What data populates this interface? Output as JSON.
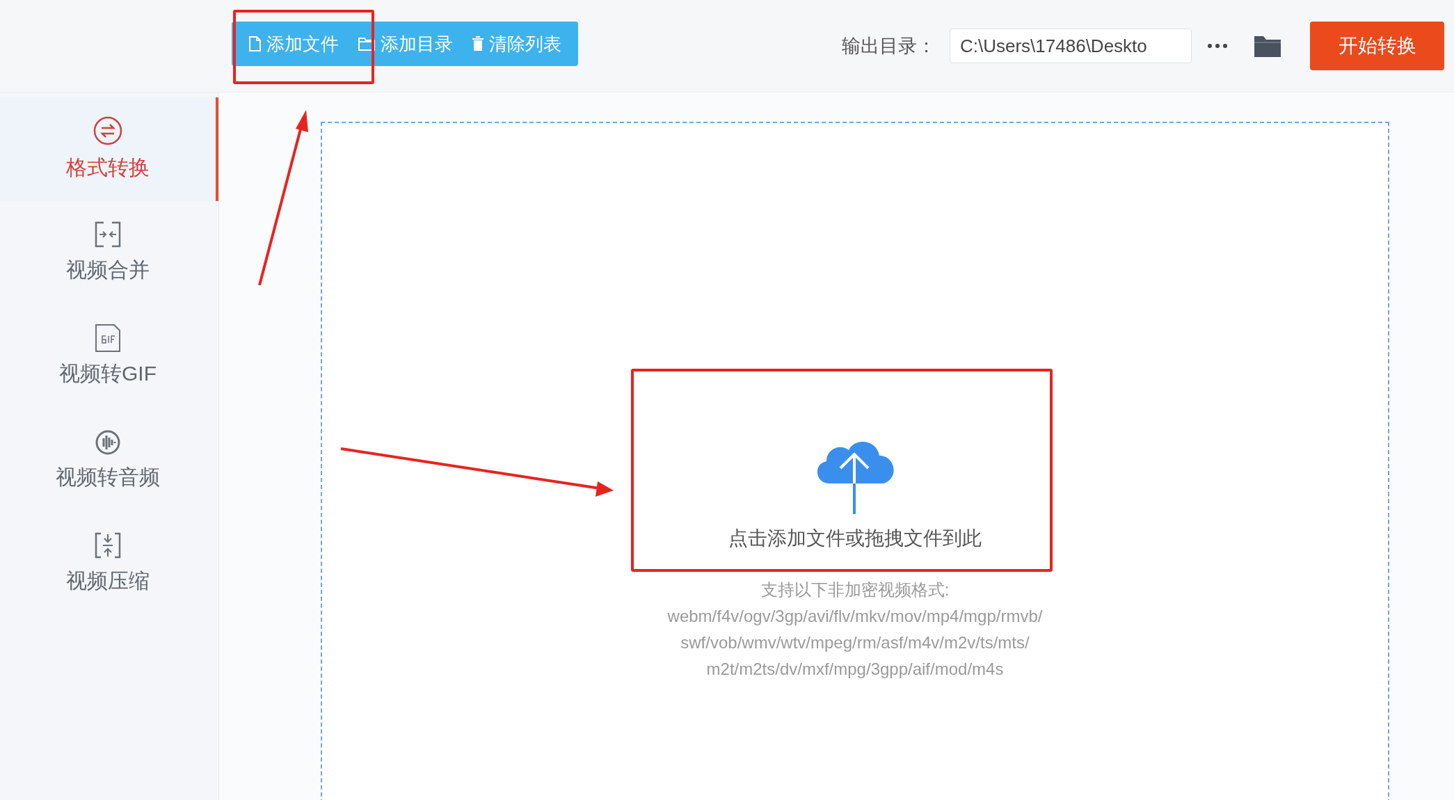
{
  "toolbar": {
    "buttons": [
      {
        "label": "添加文件",
        "kind": "file"
      },
      {
        "label": "添加目录",
        "kind": "folder"
      },
      {
        "label": "清除列表",
        "kind": "trash"
      }
    ]
  },
  "output": {
    "label": "输出目录：",
    "value": "C:\\Users\\17486\\Deskto"
  },
  "start_button": "开始转换",
  "sidebar": {
    "items": [
      {
        "label": "格式转换",
        "kind": "convert",
        "selected": true
      },
      {
        "label": "视频合并",
        "kind": "merge",
        "selected": false
      },
      {
        "label": "视频转GIF",
        "kind": "gif",
        "selected": false
      },
      {
        "label": "视频转音频",
        "kind": "audio",
        "selected": false
      },
      {
        "label": "视频压缩",
        "kind": "compress",
        "selected": false
      }
    ]
  },
  "dropzone": {
    "prompt": "点击添加文件或拖拽文件到此",
    "formats_title": "支持以下非加密视频格式:",
    "formats": [
      "webm/f4v/ogv/3gp/avi/flv/mkv/mov/mp4/mgp/rmvb/",
      "swf/vob/wmv/wtv/mpeg/rm/asf/m4v/m2v/ts/mts/",
      "m2t/m2ts/dv/mxf/mpg/3gpp/aif/mod/m4s"
    ]
  }
}
